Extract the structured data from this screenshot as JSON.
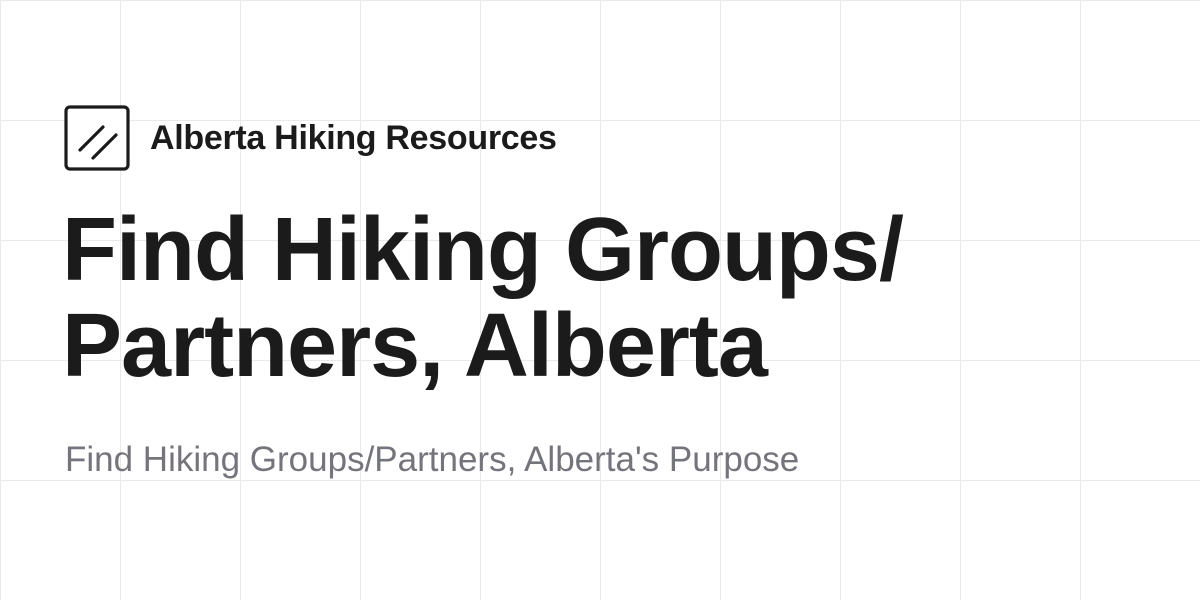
{
  "brand": {
    "site_name": "Alberta Hiking Resources",
    "logo_icon": "slash-square-icon"
  },
  "headline": {
    "line1": "Find Hiking Groups/",
    "line2": "Partners, Alberta"
  },
  "subtitle": "Find Hiking Groups/Partners, Alberta's Purpose",
  "colors": {
    "text_primary": "#1b1b1c",
    "text_muted": "#74747c",
    "grid_line": "#e9e9e9",
    "background": "#ffffff"
  }
}
